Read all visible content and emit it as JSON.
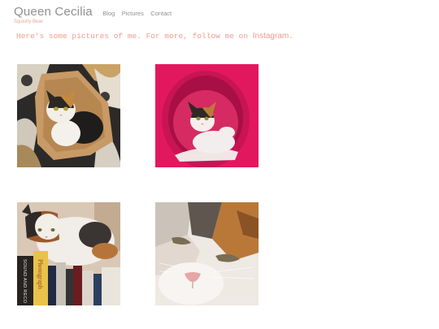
{
  "site": {
    "title": "Queen Cecilia",
    "tagline": "Squishy Bear"
  },
  "nav": {
    "items": [
      "Blog",
      "Pictures",
      "Contact"
    ]
  },
  "intro": {
    "text": "Here's some pictures of me. For more, follow me on ",
    "link_label": "Instagram",
    "suffix": "."
  },
  "photos": [
    {
      "subject": "calico cat sitting in a paper bag on patterned fabric"
    },
    {
      "subject": "calico cat inside a pink cat tunnel"
    },
    {
      "subject": "calico cat lying on top of a stack of books"
    },
    {
      "subject": "close-up of a calico cat's face"
    }
  ],
  "book_spines": [
    "SOUND AND RECO",
    "Photograph"
  ],
  "colors": {
    "title": "#8f8f8f",
    "accent": "#ef9c8e",
    "tunnel_pink": "#e2185f"
  }
}
